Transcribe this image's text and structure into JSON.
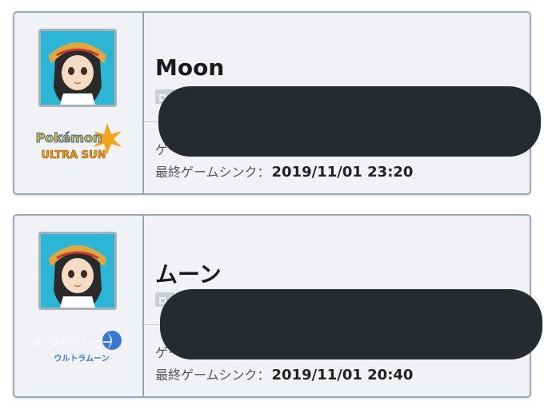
{
  "cards": [
    {
      "name": "Moon",
      "code_badge": "ロ",
      "game_label_partial": "ゲー",
      "sync_label": "最終ゲームシンク：",
      "sync_value": "2019/11/01 23:20",
      "game_logo": "pokemon-ultra-sun-logo",
      "logo_text_top": "Pokémon",
      "logo_text_bottom": "ULTRA SUN"
    },
    {
      "name": "ムーン",
      "code_badge": "ロ",
      "game_label_partial": "ゲー",
      "sync_label": "最終ゲームシンク：",
      "sync_value": "2019/11/01 20:40",
      "game_logo": "pokemon-ultra-moon-jp-logo",
      "logo_text_top": "ポケットモンスター",
      "logo_text_bottom": "ウルトラムーン"
    }
  ],
  "colors": {
    "card_bg": "#f0f2f5",
    "card_border": "#9aa8b8",
    "redaction": "#262b30",
    "avatar_bg": "#2cb6d6"
  }
}
